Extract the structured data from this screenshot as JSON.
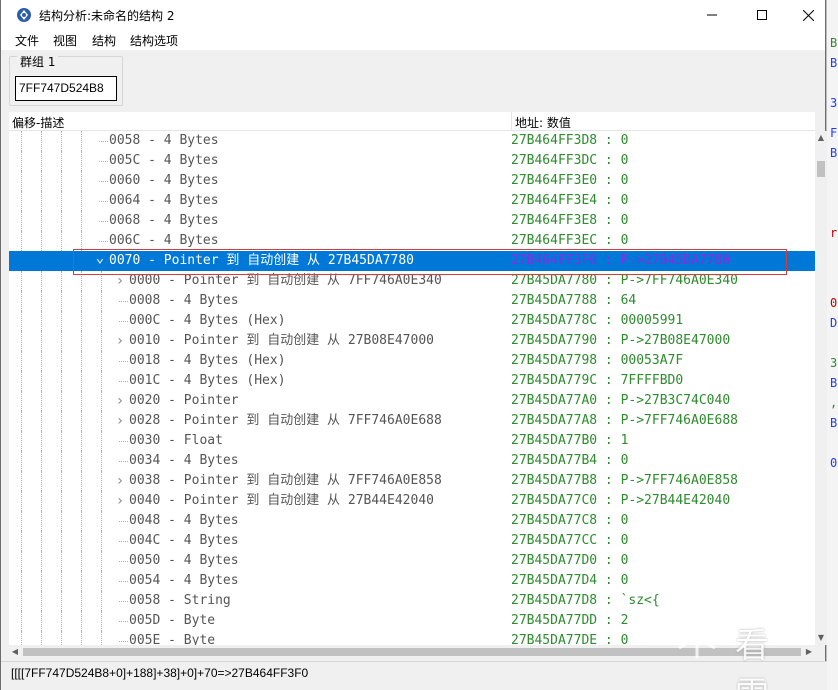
{
  "window": {
    "title": "结构分析:未命名的结构 2"
  },
  "menu": [
    "文件",
    "视图",
    "结构",
    "结构选项"
  ],
  "group": {
    "label": "群组 1",
    "address": "7FF747D524B8"
  },
  "header": {
    "col_desc": "偏移-描述",
    "col_value": "地址: 数值"
  },
  "rows": [
    {
      "depth": 1,
      "desc": "0058 - 4 Bytes",
      "value": "27B464FF3D8 : 0"
    },
    {
      "depth": 1,
      "desc": "005C - 4 Bytes",
      "value": "27B464FF3DC : 0"
    },
    {
      "depth": 1,
      "desc": "0060 - 4 Bytes",
      "value": "27B464FF3E0 : 0"
    },
    {
      "depth": 1,
      "desc": "0064 - 4 Bytes",
      "value": "27B464FF3E4 : 0"
    },
    {
      "depth": 1,
      "desc": "0068 - 4 Bytes",
      "value": "27B464FF3E8 : 0"
    },
    {
      "depth": 1,
      "desc": "006C - 4 Bytes",
      "value": "27B464FF3EC : 0"
    },
    {
      "depth": 1,
      "desc": "0070 - Pointer 到 自动创建 从 27B45DA7780",
      "value": "27B464FF3F0 : P->27B45DA7780",
      "selected": true,
      "expander": "expanded"
    },
    {
      "depth": 2,
      "desc": "0000 - Pointer 到 自动创建 从 7FF746A0E340",
      "value": "27B45DA7780 : P->7FF746A0E340",
      "expander": "collapsed"
    },
    {
      "depth": 2,
      "desc": "0008 - 4 Bytes",
      "value": "27B45DA7788 : 64"
    },
    {
      "depth": 2,
      "desc": "000C - 4 Bytes (Hex)",
      "value": "27B45DA778C : 00005991"
    },
    {
      "depth": 2,
      "desc": "0010 - Pointer 到 自动创建 从 27B08E47000",
      "value": "27B45DA7790 : P->27B08E47000",
      "expander": "collapsed"
    },
    {
      "depth": 2,
      "desc": "0018 - 4 Bytes (Hex)",
      "value": "27B45DA7798 : 00053A7F"
    },
    {
      "depth": 2,
      "desc": "001C - 4 Bytes (Hex)",
      "value": "27B45DA779C : 7FFFFBD0"
    },
    {
      "depth": 2,
      "desc": "0020 - Pointer",
      "value": "27B45DA77A0 : P->27B3C74C040",
      "expander": "collapsed"
    },
    {
      "depth": 2,
      "desc": "0028 - Pointer 到 自动创建 从 7FF746A0E688",
      "value": "27B45DA77A8 : P->7FF746A0E688",
      "expander": "collapsed"
    },
    {
      "depth": 2,
      "desc": "0030 - Float",
      "value": "27B45DA77B0 : 1"
    },
    {
      "depth": 2,
      "desc": "0034 - 4 Bytes",
      "value": "27B45DA77B4 : 0"
    },
    {
      "depth": 2,
      "desc": "0038 - Pointer 到 自动创建 从 7FF746A0E858",
      "value": "27B45DA77B8 : P->7FF746A0E858",
      "expander": "collapsed"
    },
    {
      "depth": 2,
      "desc": "0040 - Pointer 到 自动创建 从 27B44E42040",
      "value": "27B45DA77C0 : P->27B44E42040",
      "expander": "collapsed"
    },
    {
      "depth": 2,
      "desc": "0048 - 4 Bytes",
      "value": "27B45DA77C8 : 0"
    },
    {
      "depth": 2,
      "desc": "004C - 4 Bytes",
      "value": "27B45DA77CC : 0"
    },
    {
      "depth": 2,
      "desc": "0050 - 4 Bytes",
      "value": "27B45DA77D0 : 0"
    },
    {
      "depth": 2,
      "desc": "0054 - 4 Bytes",
      "value": "27B45DA77D4 : 0"
    },
    {
      "depth": 2,
      "desc": "0058 - String",
      "value": "27B45DA77D8 : `sz<{"
    },
    {
      "depth": 2,
      "desc": "005D - Byte",
      "value": "27B45DA77DD : 2"
    },
    {
      "depth": 2,
      "desc": "005E - Byte",
      "value": "27B45DA77DE : 0"
    }
  ],
  "status": "[[[[7FF747D524B8+0]+188]+38]+0]+70=>27B464FF3F0",
  "watermark": "看雪",
  "bg_window_glyphs": [
    "B",
    "B",
    "38",
    "F",
    "B",
    "rl",
    "0",
    "D",
    "3",
    "B",
    ",0",
    "B",
    "0]"
  ],
  "colors": {
    "selection": "#0078d7",
    "value_text": "#2e8b2e",
    "selected_value_text": "#8a2be2",
    "highlight_box": "#d83b3b"
  },
  "icons": {
    "app": "cheat-engine-icon",
    "expanded": "chevron-down-icon",
    "collapsed": "chevron-right-icon"
  }
}
